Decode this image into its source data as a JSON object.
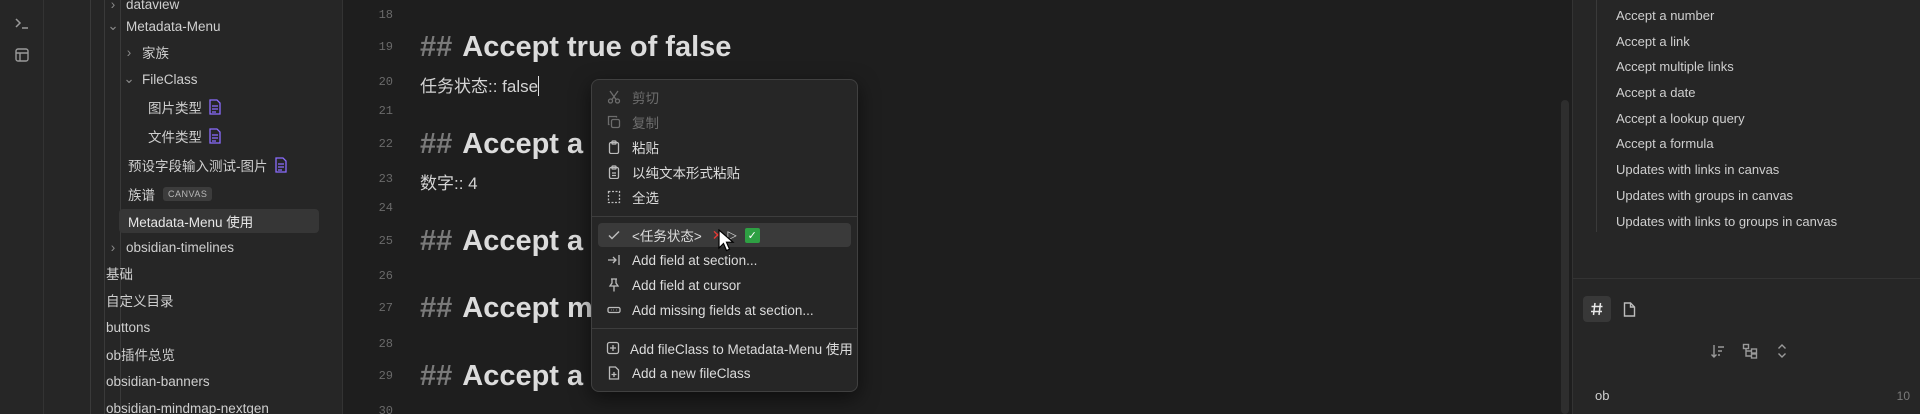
{
  "file_tree": {
    "items": [
      {
        "label": "dataview",
        "kind": "folder-collapsed"
      },
      {
        "label": "Metadata-Menu",
        "kind": "folder-open"
      },
      {
        "label": "家族",
        "kind": "folder-collapsed"
      },
      {
        "label": "FileClass",
        "kind": "folder-open"
      },
      {
        "label": "图片类型",
        "kind": "file-badge"
      },
      {
        "label": "文件类型",
        "kind": "file-badge"
      },
      {
        "label": "预设字段输入测试-图片",
        "kind": "file-badge"
      },
      {
        "label": "族谱",
        "kind": "canvas",
        "tag": "CANVAS"
      },
      {
        "label": "Metadata-Menu 使用",
        "kind": "active"
      },
      {
        "label": "obsidian-timelines",
        "kind": "folder-collapsed"
      },
      {
        "label": "基础",
        "kind": "file"
      },
      {
        "label": "自定义目录",
        "kind": "file"
      },
      {
        "label": "buttons",
        "kind": "file"
      },
      {
        "label": "ob插件总览",
        "kind": "file"
      },
      {
        "label": "obsidian-banners",
        "kind": "file"
      },
      {
        "label": "obsidian-mindmap-nextgen",
        "kind": "file"
      }
    ]
  },
  "editor": {
    "lines": [
      {
        "num": "18",
        "type": "blank",
        "text": ""
      },
      {
        "num": "19",
        "type": "heading",
        "hash": "##",
        "text": "Accept true of false"
      },
      {
        "num": "20",
        "type": "prop",
        "text": "任务状态:: false"
      },
      {
        "num": "21",
        "type": "blank",
        "text": ""
      },
      {
        "num": "22",
        "type": "heading",
        "hash": "##",
        "text": "Accept a n"
      },
      {
        "num": "23",
        "type": "prop",
        "text": "数字:: 4"
      },
      {
        "num": "24",
        "type": "blank",
        "text": ""
      },
      {
        "num": "25",
        "type": "heading",
        "hash": "##",
        "text": "Accept a l"
      },
      {
        "num": "26",
        "type": "blank",
        "text": ""
      },
      {
        "num": "27",
        "type": "heading",
        "hash": "##",
        "text": "Accept m"
      },
      {
        "num": "28",
        "type": "blank",
        "text": ""
      },
      {
        "num": "29",
        "type": "heading",
        "hash": "##",
        "text": "Accept a d"
      },
      {
        "num": "30",
        "type": "blank",
        "text": ""
      }
    ]
  },
  "context_menu": {
    "cut": "剪切",
    "copy": "复制",
    "paste": "粘贴",
    "paste_plain": "以纯文本形式粘贴",
    "select_all": "全选",
    "field_toggle": "<任务状态>",
    "add_field_section": "Add field at section...",
    "add_field_cursor": "Add field at cursor",
    "add_missing": "Add missing fields at section...",
    "add_fileclass_to": "Add fileClass to Metadata-Menu 使用",
    "add_new_fileclass": "Add a new fileClass"
  },
  "outline": {
    "items": [
      "Accept a number",
      "Accept a link",
      "Accept multiple links",
      "Accept a date",
      "Accept a lookup query",
      "Accept a formula",
      "Updates with links in canvas",
      "Updates with groups in canvas",
      "Updates with links to groups in canvas"
    ]
  },
  "tags_pane": {
    "tag_name": "ob",
    "tag_count": "10"
  },
  "colors": {
    "accent_purple": "#8b6cff",
    "false_red": "#e53935",
    "true_green": "#2ea043"
  }
}
